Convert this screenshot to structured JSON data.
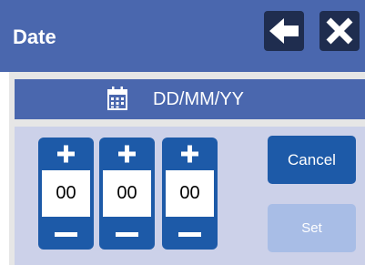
{
  "title": "Date",
  "toolbar": {
    "back_icon": "arrow-left-icon",
    "close_icon": "close-icon"
  },
  "picker": {
    "header_icon": "calendar-icon",
    "format_label": "DD/MM/YY",
    "fields": [
      {
        "name": "day",
        "value": "00"
      },
      {
        "name": "month",
        "value": "00"
      },
      {
        "name": "year",
        "value": "00"
      }
    ]
  },
  "actions": {
    "cancel_label": "Cancel",
    "set_label": "Set",
    "set_enabled": false
  },
  "colors": {
    "title_bar": "#4a67ae",
    "button_dark": "#1f2d4f",
    "control_blue": "#1d5aa8",
    "panel_bg": "#ccd1e9",
    "disabled_button": "#a8bde6"
  }
}
